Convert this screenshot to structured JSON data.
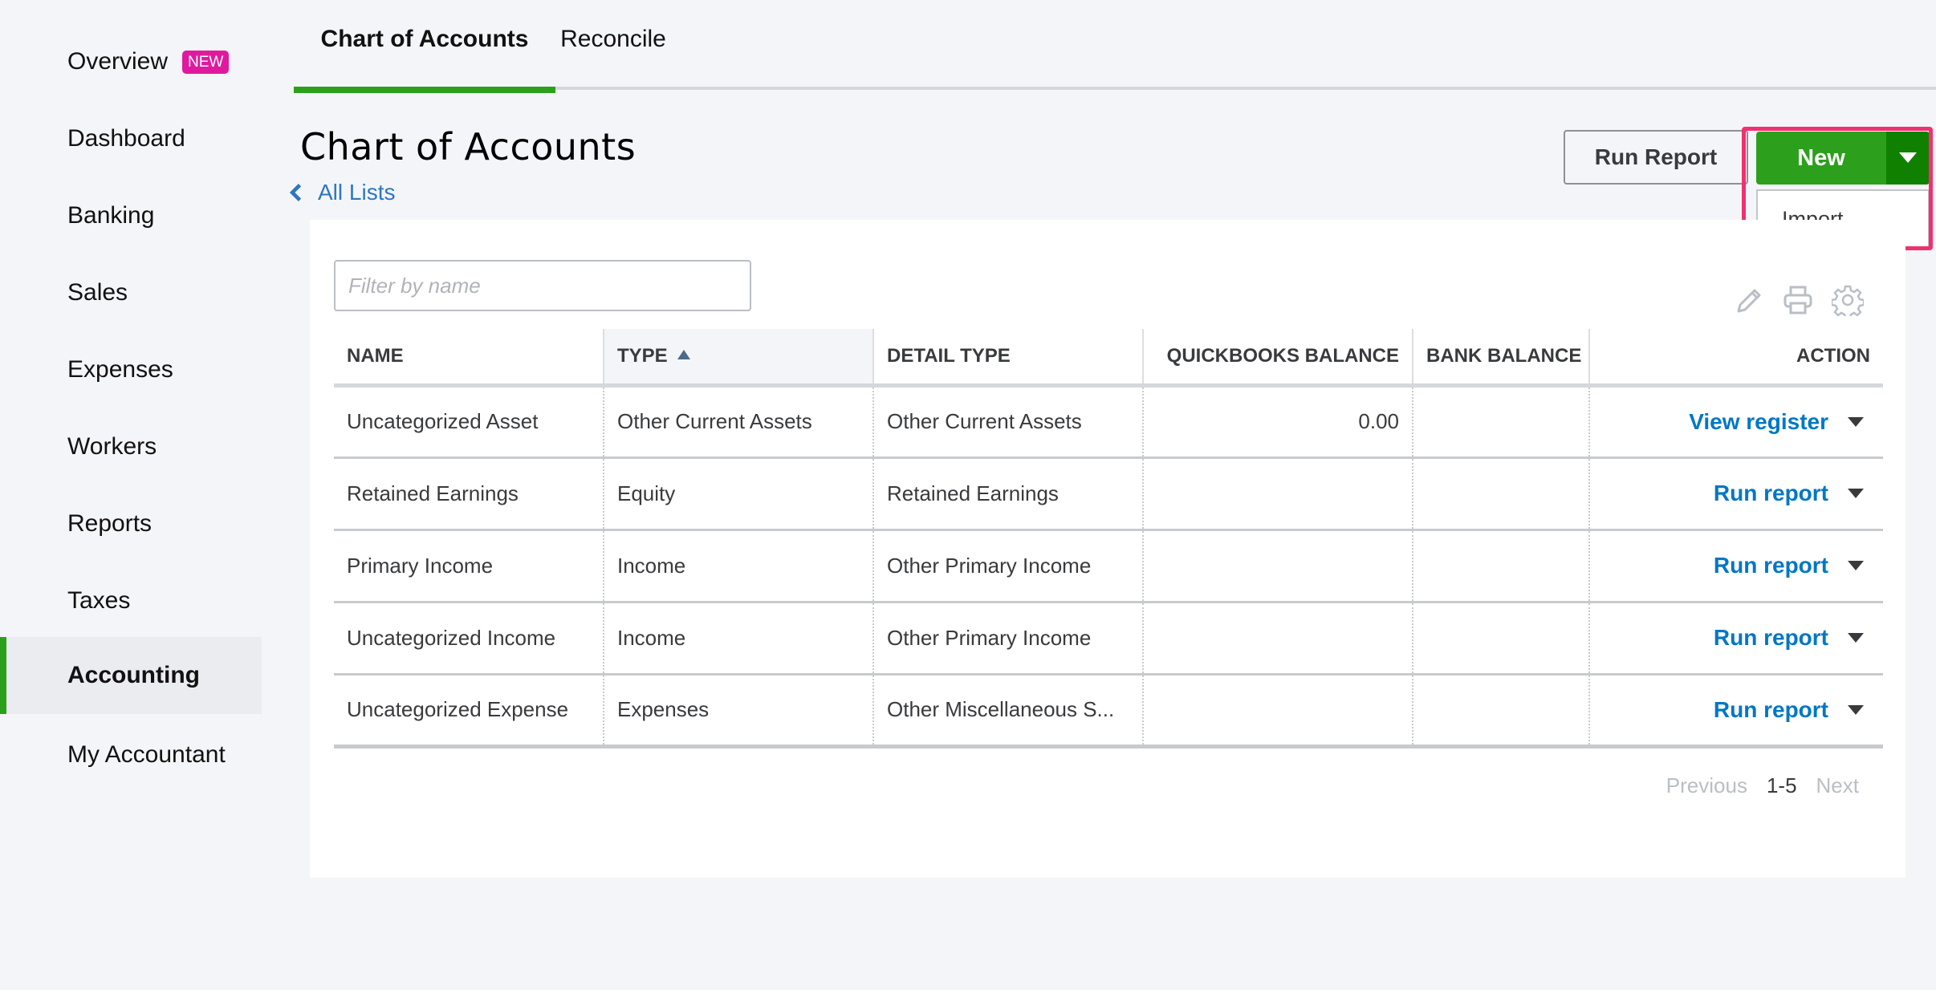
{
  "sidebar": {
    "items": [
      {
        "label": "Overview",
        "badge": "NEW",
        "active": false
      },
      {
        "label": "Dashboard",
        "active": false
      },
      {
        "label": "Banking",
        "active": false
      },
      {
        "label": "Sales",
        "active": false
      },
      {
        "label": "Expenses",
        "active": false
      },
      {
        "label": "Workers",
        "active": false
      },
      {
        "label": "Reports",
        "active": false
      },
      {
        "label": "Taxes",
        "active": false
      },
      {
        "label": "Accounting",
        "active": true
      },
      {
        "label": "My Accountant",
        "active": false
      }
    ]
  },
  "tabs": [
    {
      "label": "Chart of Accounts",
      "active": true
    },
    {
      "label": "Reconcile",
      "active": false
    }
  ],
  "header": {
    "title": "Chart of Accounts",
    "back_link": "All Lists",
    "run_report_label": "Run Report",
    "new_label": "New",
    "dropdown_items": [
      "Import"
    ]
  },
  "filter": {
    "placeholder": "Filter by name",
    "value": ""
  },
  "toolbar": {
    "icons": [
      "pencil-icon",
      "printer-icon",
      "gear-icon"
    ]
  },
  "table": {
    "columns": [
      "NAME",
      "TYPE",
      "DETAIL TYPE",
      "QUICKBOOKS BALANCE",
      "BANK BALANCE",
      "ACTION"
    ],
    "sorted_column": "TYPE",
    "sort_direction": "ascending",
    "rows": [
      {
        "name": "Uncategorized Asset",
        "type": "Other Current Assets",
        "detail_type": "Other Current Assets",
        "qb_balance": "0.00",
        "bank_balance": "",
        "action": "View register"
      },
      {
        "name": "Retained Earnings",
        "type": "Equity",
        "detail_type": "Retained Earnings",
        "qb_balance": "",
        "bank_balance": "",
        "action": "Run report"
      },
      {
        "name": "Primary Income",
        "type": "Income",
        "detail_type": "Other Primary Income",
        "qb_balance": "",
        "bank_balance": "",
        "action": "Run report"
      },
      {
        "name": "Uncategorized Income",
        "type": "Income",
        "detail_type": "Other Primary Income",
        "qb_balance": "",
        "bank_balance": "",
        "action": "Run report"
      },
      {
        "name": "Uncategorized Expense",
        "type": "Expenses",
        "detail_type": "Other Miscellaneous S...",
        "qb_balance": "",
        "bank_balance": "",
        "action": "Run report"
      }
    ]
  },
  "pagination": {
    "previous": "Previous",
    "range": "1-5",
    "next": "Next"
  },
  "colors": {
    "brand_green": "#2ca01c",
    "dark_green": "#108000",
    "link_blue": "#0077c5",
    "badge_pink": "#e01a9e",
    "highlight": "#f0316f"
  }
}
